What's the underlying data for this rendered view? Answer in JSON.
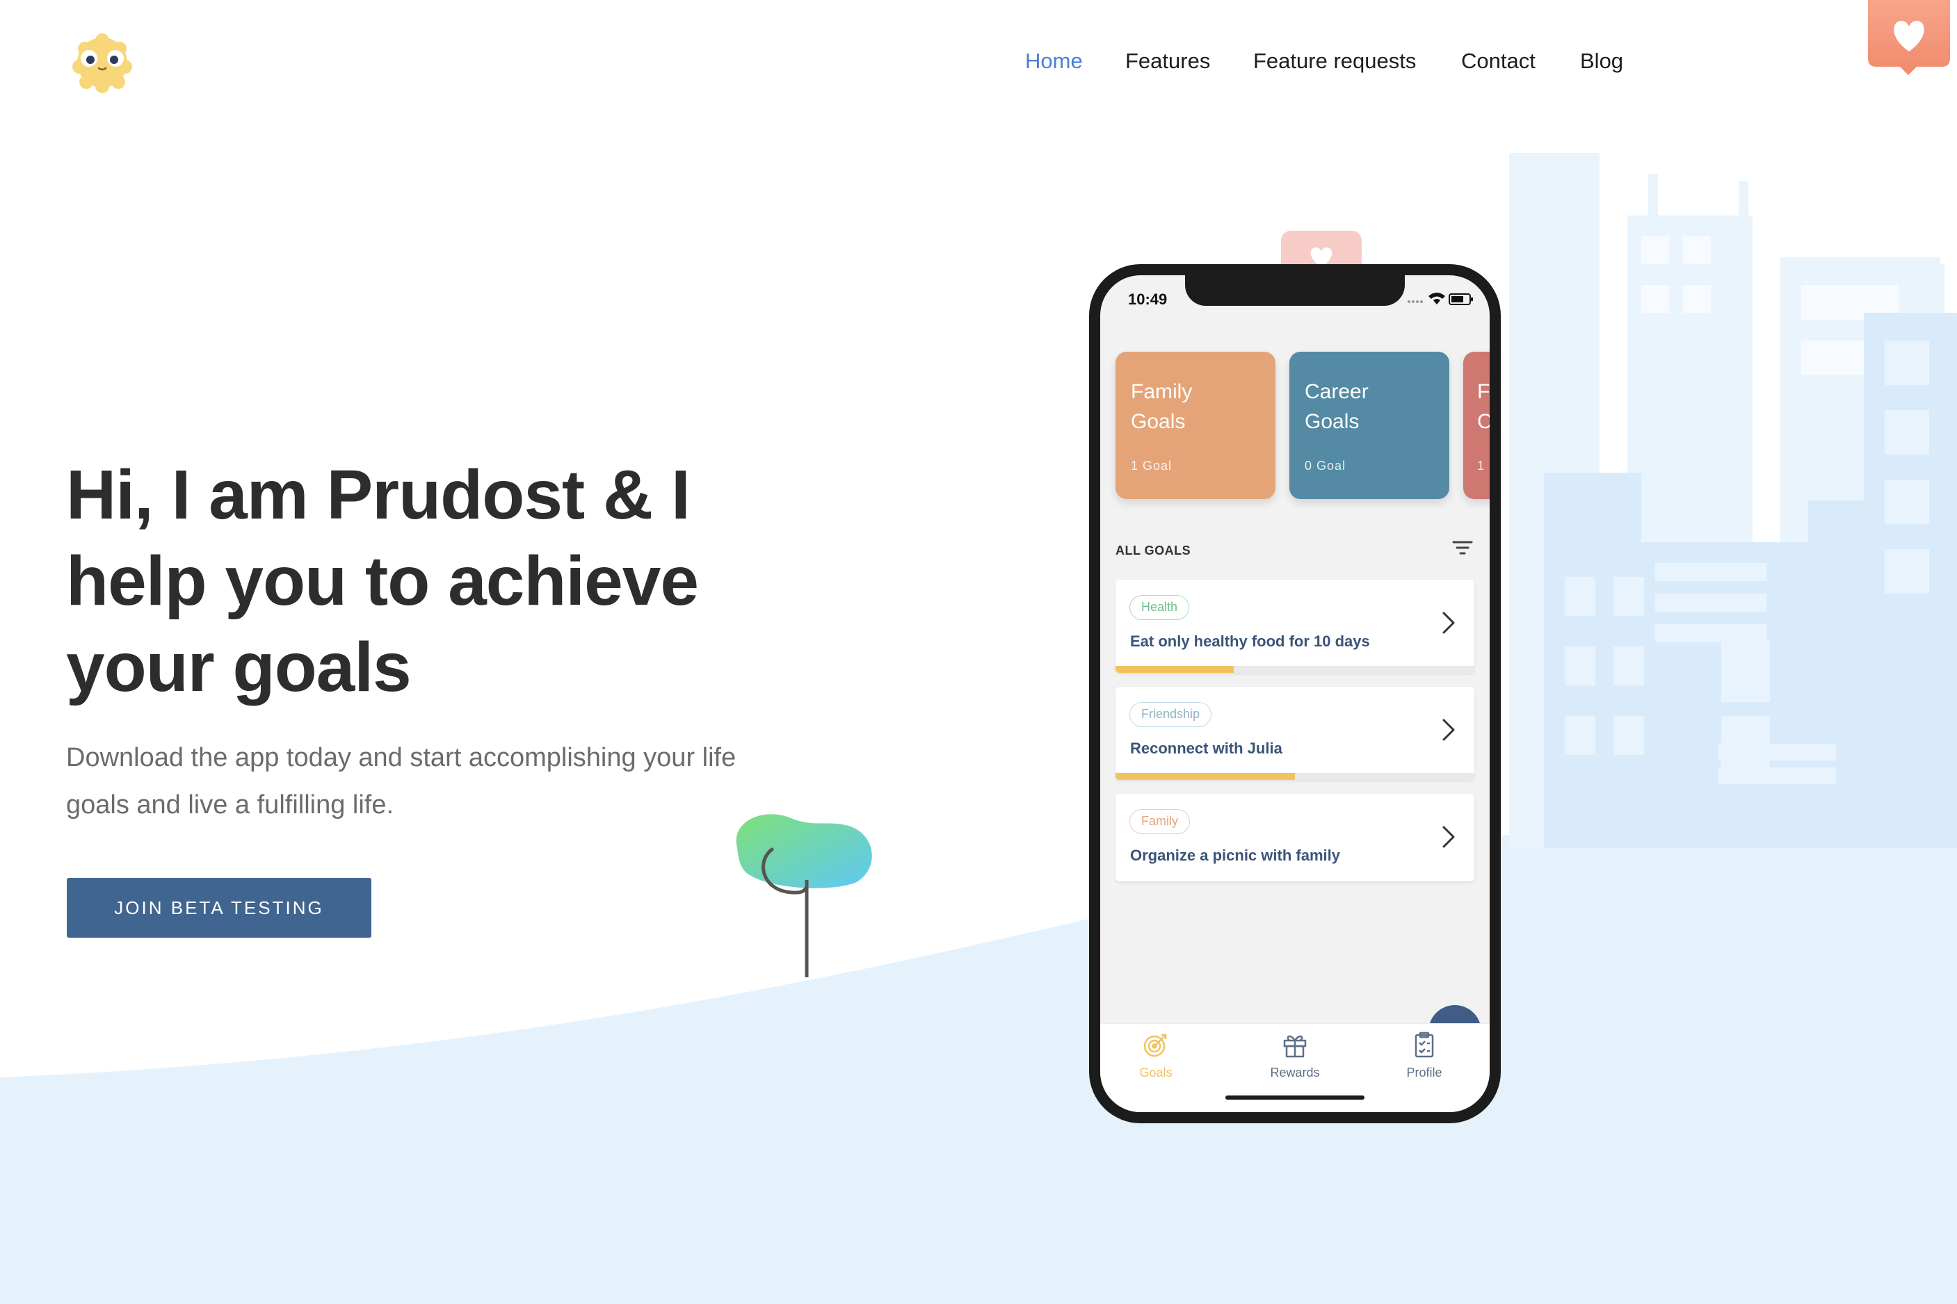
{
  "nav": {
    "items": [
      {
        "label": "Home",
        "active": true
      },
      {
        "label": "Features",
        "active": false
      },
      {
        "label": "Feature requests",
        "active": false
      },
      {
        "label": "Contact",
        "active": false
      },
      {
        "label": "Blog",
        "active": false
      }
    ]
  },
  "icons": {
    "logo": "mascot-logo-icon",
    "favorite": "heart-icon",
    "filter": "filter-icon",
    "chevron": "chevron-right-icon",
    "tree": "tree-illustration"
  },
  "hero": {
    "title_lines": [
      "Hi, I am Prudost & I",
      "help you to achieve",
      "your goals"
    ],
    "subtitle_lines": [
      "Download the app today and start accomplishing your life",
      "goals and live a fulfilling life."
    ],
    "cta_label": "JOIN BETA TESTING"
  },
  "phone": {
    "time": "10:49",
    "categories": [
      {
        "title_line1": "Family",
        "title_line2": "Goals",
        "count": "1 Goal",
        "color": "#e4a478"
      },
      {
        "title_line1": "Career",
        "title_line2": "Goals",
        "count": "0 Goal",
        "color": "#548aa3"
      },
      {
        "title_line1": "F",
        "title_line2": "C",
        "count": "1",
        "color": "#cf7771"
      }
    ],
    "all_goals_label": "ALL GOALS",
    "goals": [
      {
        "tag": "Health",
        "tag_color": "#6cc08b",
        "text": "Eat only healthy food for 10 days",
        "progress": 0.33
      },
      {
        "tag": "Friendship",
        "tag_color": "#8fb3c6",
        "text": "Reconnect with Julia",
        "progress": 0.5
      },
      {
        "tag": "Family",
        "tag_color": "#e4a478",
        "text": "Organize a picnic with family",
        "progress": null
      }
    ],
    "tabs": [
      {
        "label": "Goals",
        "icon": "target-icon",
        "active": true
      },
      {
        "label": "Rewards",
        "icon": "gift-icon",
        "active": false
      },
      {
        "label": "Profile",
        "icon": "clipboard-icon",
        "active": false
      }
    ]
  },
  "colors": {
    "accent": "#4a7fd6",
    "cta": "#3f6590",
    "hill": "#e5f2fc",
    "progress": "#f2c25f"
  }
}
